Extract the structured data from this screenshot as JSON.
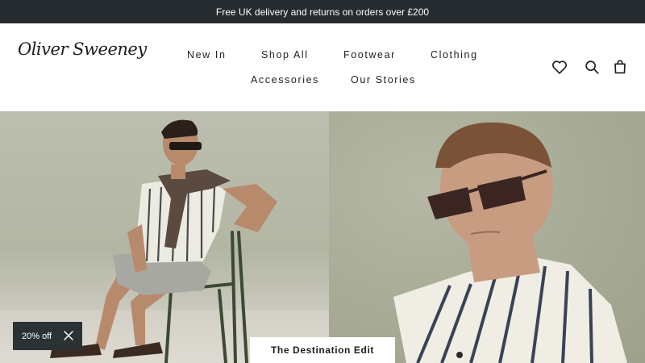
{
  "promo_bar": {
    "text": "Free UK delivery and returns on orders over £200"
  },
  "header": {
    "logo_text": "Oliver Sweeney",
    "nav": {
      "new_in": "New In",
      "shop_all": "Shop All",
      "footwear": "Footwear",
      "clothing": "Clothing",
      "accessories": "Accessories",
      "our_stories": "Our Stories"
    },
    "icons": [
      "heart-icon",
      "search-icon",
      "shopping-bag-icon"
    ]
  },
  "hero": {
    "cta_label": "The Destination Edit"
  },
  "discount": {
    "label": "20% off",
    "close_icon": "close-icon"
  },
  "colors": {
    "promo_bg": "#252b2f",
    "header_bg": "#ffffff",
    "text_dark": "#222222",
    "discount_bg": "#2a3236",
    "cta_bg": "#ffffff"
  }
}
